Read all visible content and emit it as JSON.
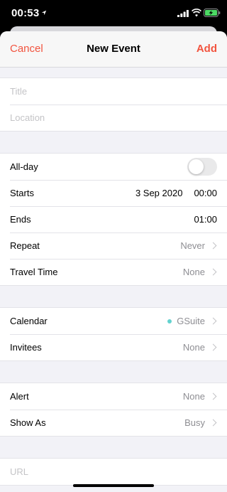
{
  "status": {
    "time": "00:53"
  },
  "nav": {
    "cancel": "Cancel",
    "title": "New Event",
    "add": "Add"
  },
  "fields": {
    "title_placeholder": "Title",
    "location_placeholder": "Location",
    "url_placeholder": "URL"
  },
  "time_group": {
    "allday_label": "All-day",
    "allday_on": false,
    "starts_label": "Starts",
    "starts_date": "3 Sep 2020",
    "starts_time": "00:00",
    "ends_label": "Ends",
    "ends_time": "01:00",
    "repeat_label": "Repeat",
    "repeat_value": "Never",
    "travel_label": "Travel Time",
    "travel_value": "None"
  },
  "calendar_group": {
    "calendar_label": "Calendar",
    "calendar_value": "GSuite",
    "calendar_color": "#63d2cf",
    "invitees_label": "Invitees",
    "invitees_value": "None"
  },
  "alert_group": {
    "alert_label": "Alert",
    "alert_value": "None",
    "showas_label": "Show As",
    "showas_value": "Busy"
  },
  "colors": {
    "accent": "#f2543f",
    "background": "#f2f2f7"
  }
}
